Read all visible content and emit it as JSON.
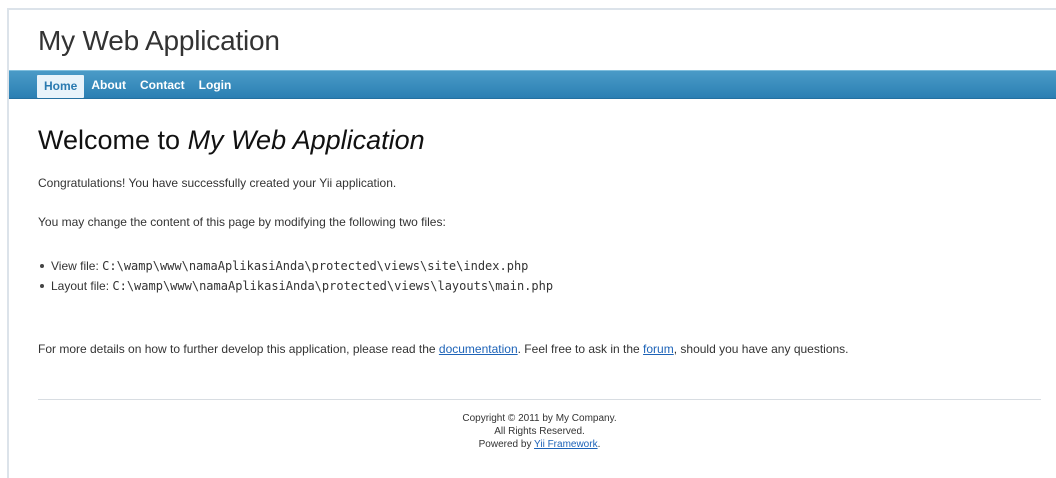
{
  "header": {
    "logo": "My Web Application"
  },
  "menu": {
    "items": [
      {
        "label": "Home",
        "active": true
      },
      {
        "label": "About",
        "active": false
      },
      {
        "label": "Contact",
        "active": false
      },
      {
        "label": "Login",
        "active": false
      }
    ]
  },
  "content": {
    "title_prefix": "Welcome to ",
    "title_app": "My Web Application",
    "congrats": "Congratulations! You have successfully created your Yii application.",
    "change_text": "You may change the content of this page by modifying the following two files:",
    "files": [
      {
        "label": "View file: ",
        "path": "C:\\wamp\\www\\namaAplikasiAnda\\protected\\views\\site\\index.php"
      },
      {
        "label": "Layout file: ",
        "path": "C:\\wamp\\www\\namaAplikasiAnda\\protected\\views\\layouts\\main.php"
      }
    ],
    "more_prefix": "For more details on how to further develop this application, please read the ",
    "doc_link": "documentation",
    "more_middle": ". Feel free to ask in the ",
    "forum_link": "forum",
    "more_suffix": ", should you have any questions."
  },
  "footer": {
    "copyright": "Copyright © 2011 by My Company.",
    "rights": "All Rights Reserved.",
    "powered_prefix": "Powered by ",
    "powered_link": "Yii Framework",
    "powered_suffix": "."
  },
  "colors": {
    "menu_bar": "#2b7fb3",
    "active_tab_bg": "#e8f3fa",
    "link": "#1d63b8"
  }
}
